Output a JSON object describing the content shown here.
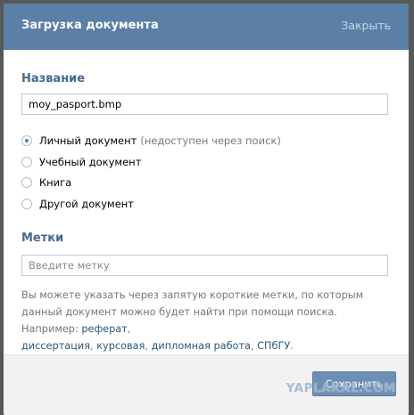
{
  "dialog": {
    "title": "Загрузка документа",
    "close_label": "Закрыть"
  },
  "name_section": {
    "label": "Название",
    "value": "moy_pasport.bmp"
  },
  "doc_types": {
    "selected_index": 0,
    "options": [
      {
        "label": "Личный документ",
        "hint": "(недоступен через поиск)"
      },
      {
        "label": "Учебный документ",
        "hint": ""
      },
      {
        "label": "Книга",
        "hint": ""
      },
      {
        "label": "Другой документ",
        "hint": ""
      }
    ]
  },
  "tags_section": {
    "label": "Метки",
    "placeholder": "Введите метку",
    "value": ""
  },
  "help": {
    "text_1": "Вы можете указать через запятую короткие метки, по которым данный документ можно будет найти при помощи поиска. Например: ",
    "example_1": "реферат",
    "sep_1": ",",
    "example_2": "диссертация",
    "sep_2": ", ",
    "example_3": "курсовая",
    "sep_3": ", ",
    "example_4": "дипломная работа",
    "sep_4": ", ",
    "example_5": "СПбГУ",
    "end": "."
  },
  "footer": {
    "save_label": "Сохранить"
  },
  "watermark": "YAPLAKAL.COM",
  "colors": {
    "header": "#5b7fa6",
    "accent_text": "#45688e",
    "link": "#2b587a",
    "button": "#6d8fb3"
  }
}
